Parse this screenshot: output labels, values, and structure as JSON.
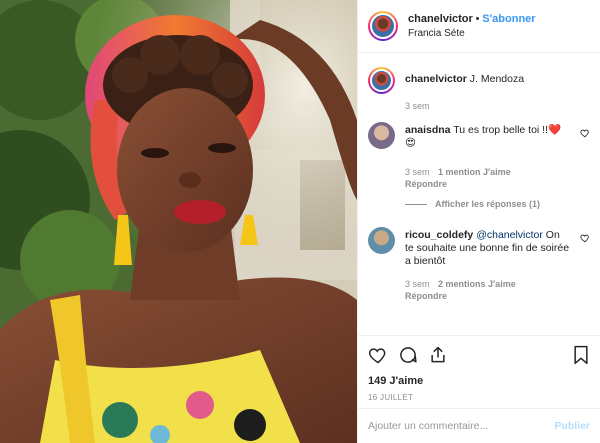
{
  "header": {
    "username": "chanelvictor",
    "separator": "•",
    "follow_label": "S'abonner",
    "location": "Francia Séte"
  },
  "caption": {
    "username": "chanelvictor",
    "text": "J. Mendoza",
    "time": "3 sem"
  },
  "comments": [
    {
      "username": "anaisdna",
      "text": "Tu es trop belle toi !!❤️😍",
      "time": "3 sem",
      "likes": "1 mention J'aime",
      "reply": "Répondre",
      "view_replies": "Afficher les réponses (1)"
    },
    {
      "username": "ricou_coldefy",
      "mention": "@chanelvictor",
      "text": " On te souhaite une bonne fin de soirée a bientôt",
      "time": "3 sem",
      "likes": "2 mentions J'aime",
      "reply": "Répondre"
    }
  ],
  "icons": [
    "heart-icon",
    "comment-icon",
    "share-icon",
    "bookmark-icon"
  ],
  "likes_count": "149 J'aime",
  "date": "16 JUILLET",
  "add_comment": {
    "placeholder": "Ajouter un commentaire...",
    "publish_label": "Publier"
  },
  "colors": {
    "accent": "#3897f0",
    "publish_disabled": "#b2dffc",
    "muted": "#8e8e8e",
    "heart": "#ed4956"
  }
}
